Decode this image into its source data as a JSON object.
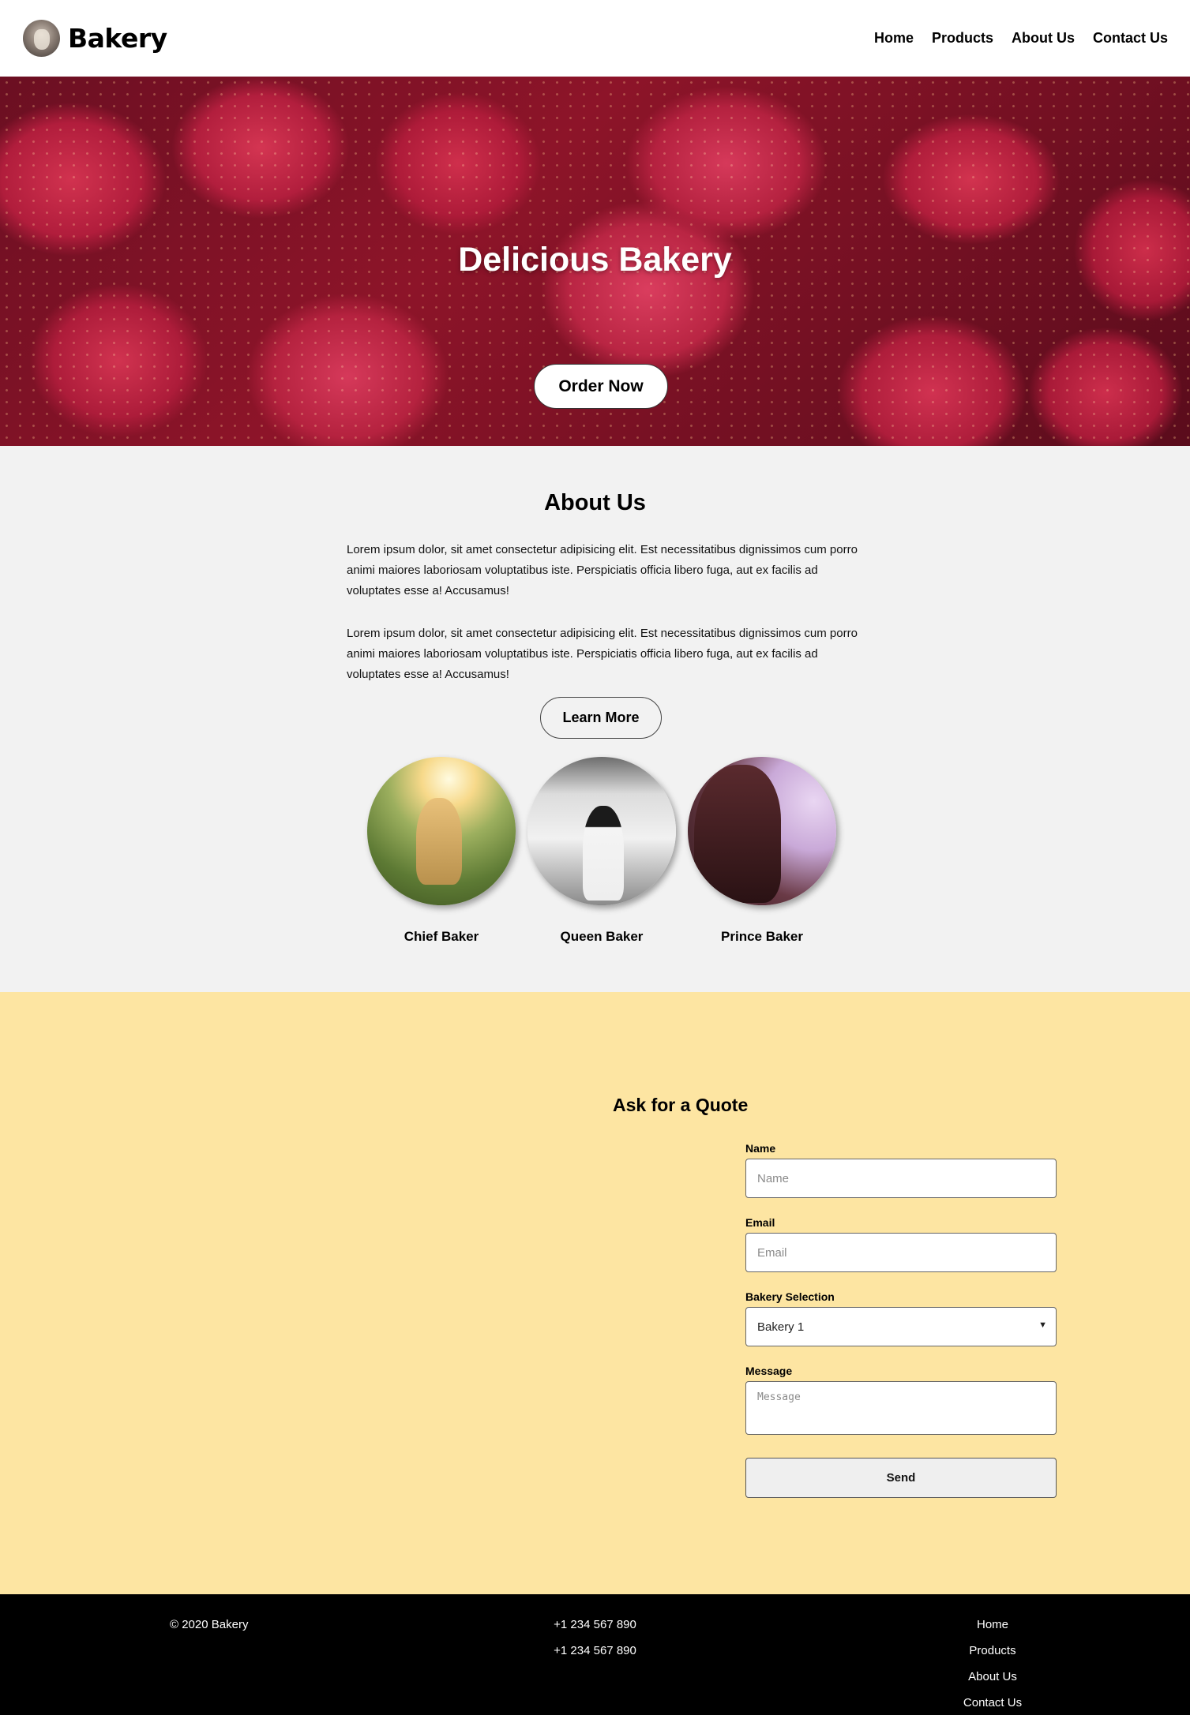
{
  "header": {
    "brand": "Bakery",
    "nav": [
      "Home",
      "Products",
      "About Us",
      "Contact Us"
    ]
  },
  "hero": {
    "title": "Delicious Bakery",
    "button": "Order Now"
  },
  "about": {
    "title": "About Us",
    "paragraphs": [
      "Lorem ipsum dolor, sit amet consectetur adipisicing elit. Est necessitatibus dignissimos cum porro animi maiores laboriosam voluptatibus iste. Perspiciatis officia libero fuga, aut ex facilis ad voluptates esse a! Accusamus!",
      "Lorem ipsum dolor, sit amet consectetur adipisicing elit. Est necessitatibus dignissimos cum porro animi maiores laboriosam voluptatibus iste. Perspiciatis officia libero fuga, aut ex facilis ad voluptates esse a! Accusamus!"
    ],
    "button": "Learn More",
    "team": [
      {
        "name": "Chief Baker"
      },
      {
        "name": "Queen Baker"
      },
      {
        "name": "Prince Baker"
      }
    ]
  },
  "quote": {
    "title": "Ask for a Quote",
    "name_label": "Name",
    "name_placeholder": "Name",
    "email_label": "Email",
    "email_placeholder": "Email",
    "bakery_label": "Bakery Selection",
    "bakery_selected": "Bakery 1",
    "message_label": "Message",
    "message_placeholder": "Message",
    "send": "Send"
  },
  "footer": {
    "copyright": "© 2020 Bakery",
    "phones": [
      "+1 234 567 890",
      "+1 234 567 890"
    ],
    "links": [
      "Home",
      "Products",
      "About Us",
      "Contact Us"
    ]
  }
}
